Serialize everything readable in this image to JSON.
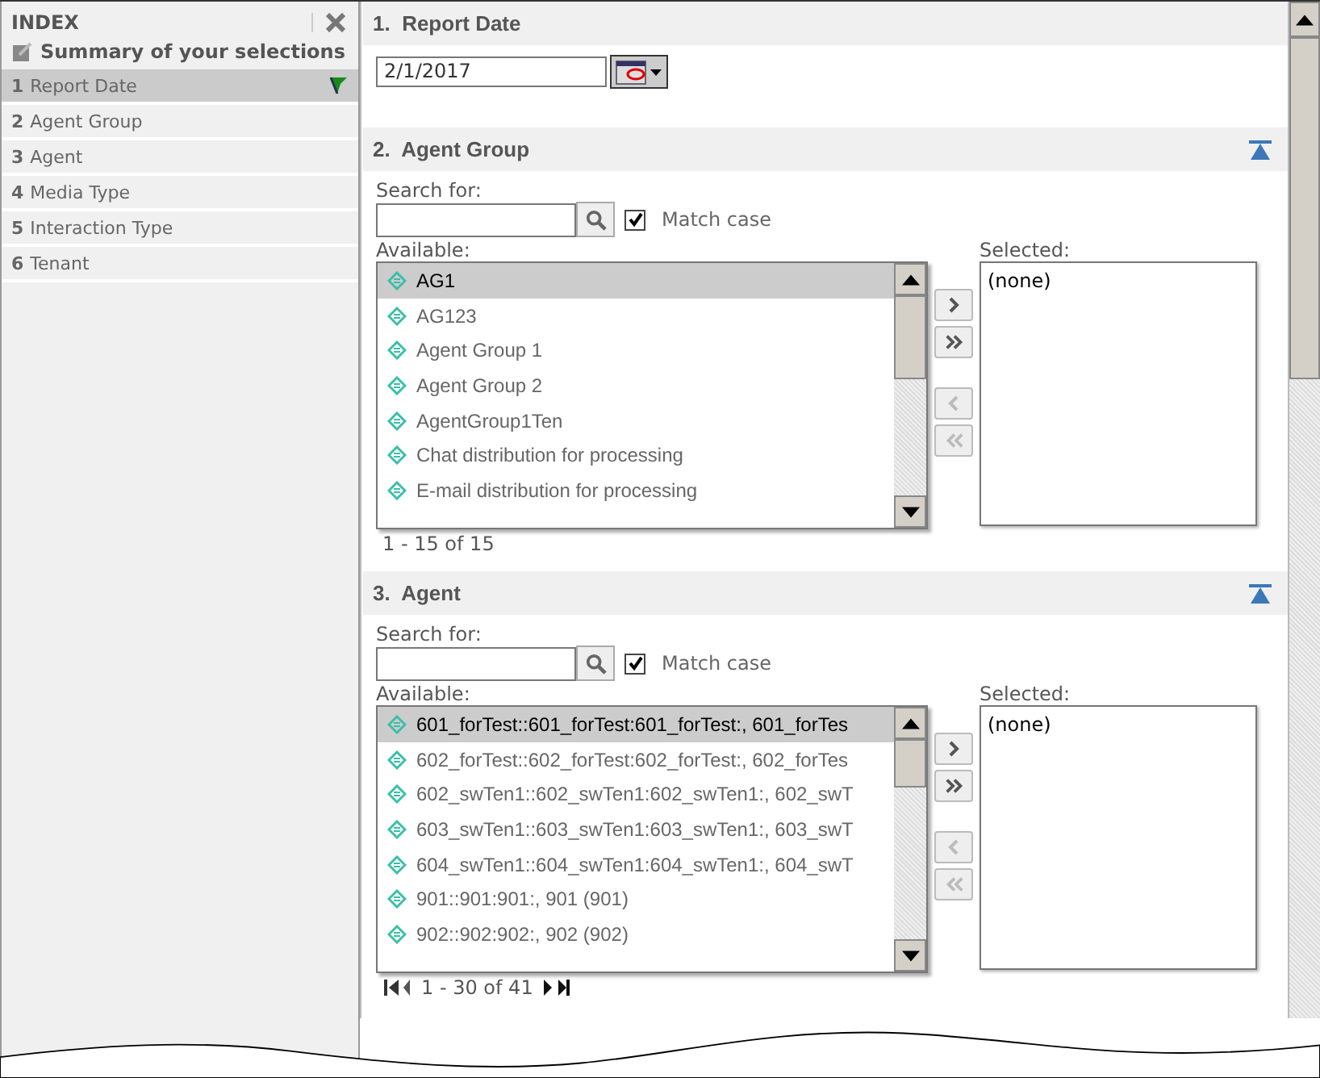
{
  "sidebar": {
    "title": "INDEX",
    "summary": "Summary of your selections",
    "items": [
      {
        "number": "1",
        "label": "Report Date",
        "selected": true,
        "flagged": true
      },
      {
        "number": "2",
        "label": "Agent Group",
        "selected": false,
        "flagged": false
      },
      {
        "number": "3",
        "label": "Agent",
        "selected": false,
        "flagged": false
      },
      {
        "number": "4",
        "label": "Media Type",
        "selected": false,
        "flagged": false
      },
      {
        "number": "5",
        "label": "Interaction Type",
        "selected": false,
        "flagged": false
      },
      {
        "number": "6",
        "label": "Tenant",
        "selected": false,
        "flagged": false
      }
    ]
  },
  "sections": [
    {
      "kind": "date",
      "number": "1.",
      "title": "Report Date",
      "collapsible": false,
      "value": "2/1/2017"
    },
    {
      "kind": "picker",
      "number": "2.",
      "title": "Agent Group",
      "collapsible": true,
      "search_label": "Search for:",
      "match_case": {
        "label": "Match case",
        "checked": true
      },
      "available_label": "Available:",
      "selected_label": "Selected:",
      "available": [
        {
          "label": "AG1",
          "selected": true
        },
        {
          "label": "AG123",
          "selected": false
        },
        {
          "label": "Agent Group 1",
          "selected": false
        },
        {
          "label": "Agent Group 2",
          "selected": false
        },
        {
          "label": "AgentGroup1Ten",
          "selected": false
        },
        {
          "label": "Chat distribution for processing",
          "selected": false
        },
        {
          "label": "E-mail distribution for processing",
          "selected": false
        }
      ],
      "chosen": [
        "(none)"
      ],
      "pager": {
        "text": "1 - 15 of 15",
        "nav": false
      }
    },
    {
      "kind": "picker",
      "number": "3.",
      "title": "Agent",
      "collapsible": true,
      "search_label": "Search for:",
      "match_case": {
        "label": "Match case",
        "checked": true
      },
      "available_label": "Available:",
      "selected_label": "Selected:",
      "available": [
        {
          "label": "601_forTest::601_forTest:601_forTest:, 601_forTes",
          "selected": true
        },
        {
          "label": "602_forTest::602_forTest:602_forTest:, 602_forTes",
          "selected": false
        },
        {
          "label": "602_swTen1::602_swTen1:602_swTen1:, 602_swT",
          "selected": false
        },
        {
          "label": "603_swTen1::603_swTen1:603_swTen1:, 603_swT",
          "selected": false
        },
        {
          "label": "604_swTen1::604_swTen1:604_swTen1:, 604_swT",
          "selected": false
        },
        {
          "label": "901::901:901:, 901 (901)",
          "selected": false
        },
        {
          "label": "902::902:902:, 902 (902)",
          "selected": false
        }
      ],
      "chosen": [
        "(none)"
      ],
      "pager": {
        "text": "1 - 30 of 41",
        "nav": true
      }
    }
  ]
}
